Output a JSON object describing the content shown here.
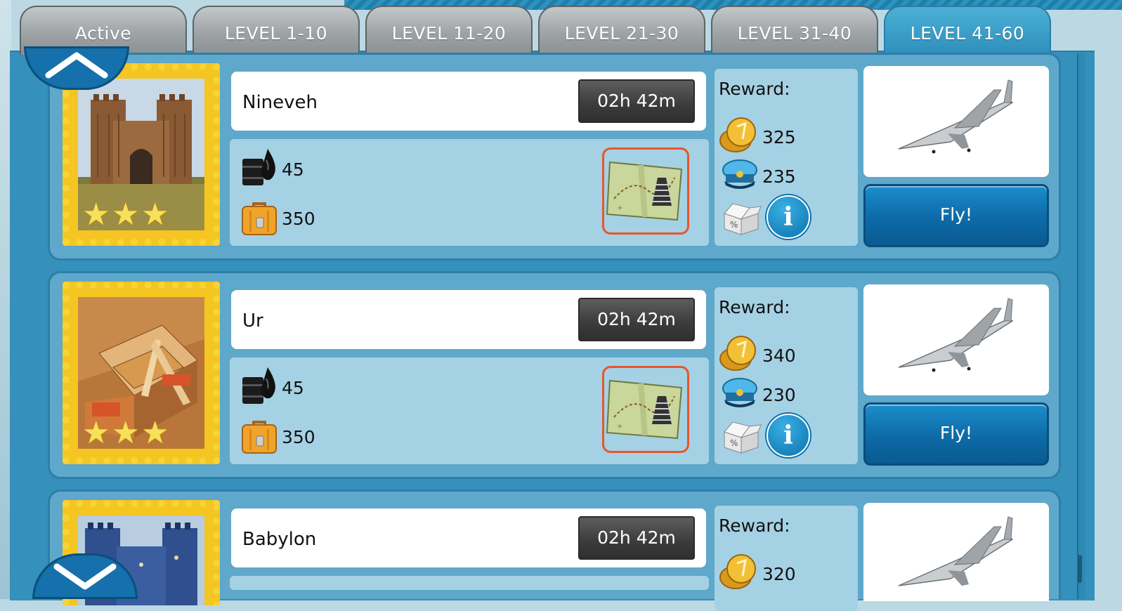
{
  "tabs": [
    {
      "label": "Active"
    },
    {
      "label": "LEVEL 1-10"
    },
    {
      "label": "LEVEL 11-20"
    },
    {
      "label": "LEVEL 21-30"
    },
    {
      "label": "LEVEL 31-40"
    },
    {
      "label": "LEVEL 41-60"
    }
  ],
  "active_tab_index": 5,
  "reward_label": "Reward:",
  "fly_label": "Fly!",
  "info_glyph": "i",
  "destinations": [
    {
      "name": "Nineveh",
      "time": "02h 42m",
      "fuel": "45",
      "luggage": "350",
      "coins": "325",
      "captains": "235",
      "stars": 3
    },
    {
      "name": "Ur",
      "time": "02h 42m",
      "fuel": "45",
      "luggage": "350",
      "coins": "340",
      "captains": "230",
      "stars": 3
    },
    {
      "name": "Babylon",
      "time": "02h 42m",
      "coins": "320"
    }
  ],
  "icons": {
    "scroll_up": "chevron-up-icon",
    "scroll_down": "chevron-down-icon",
    "fuel": "oil-barrel-icon",
    "luggage": "suitcase-icon",
    "coins": "gold-coins-icon",
    "captains": "pilot-cap-icon",
    "mystery": "open-box-icon",
    "info": "info-icon",
    "quest": "treasure-map-icon",
    "plane": "concorde-plane-icon"
  },
  "colors": {
    "tab_active": "#3aa2cc",
    "tab_inactive": "#9ea3a6",
    "fly_button": "#0d6aa6",
    "quest_border": "#e8552b",
    "stamp": "#f5c521"
  }
}
